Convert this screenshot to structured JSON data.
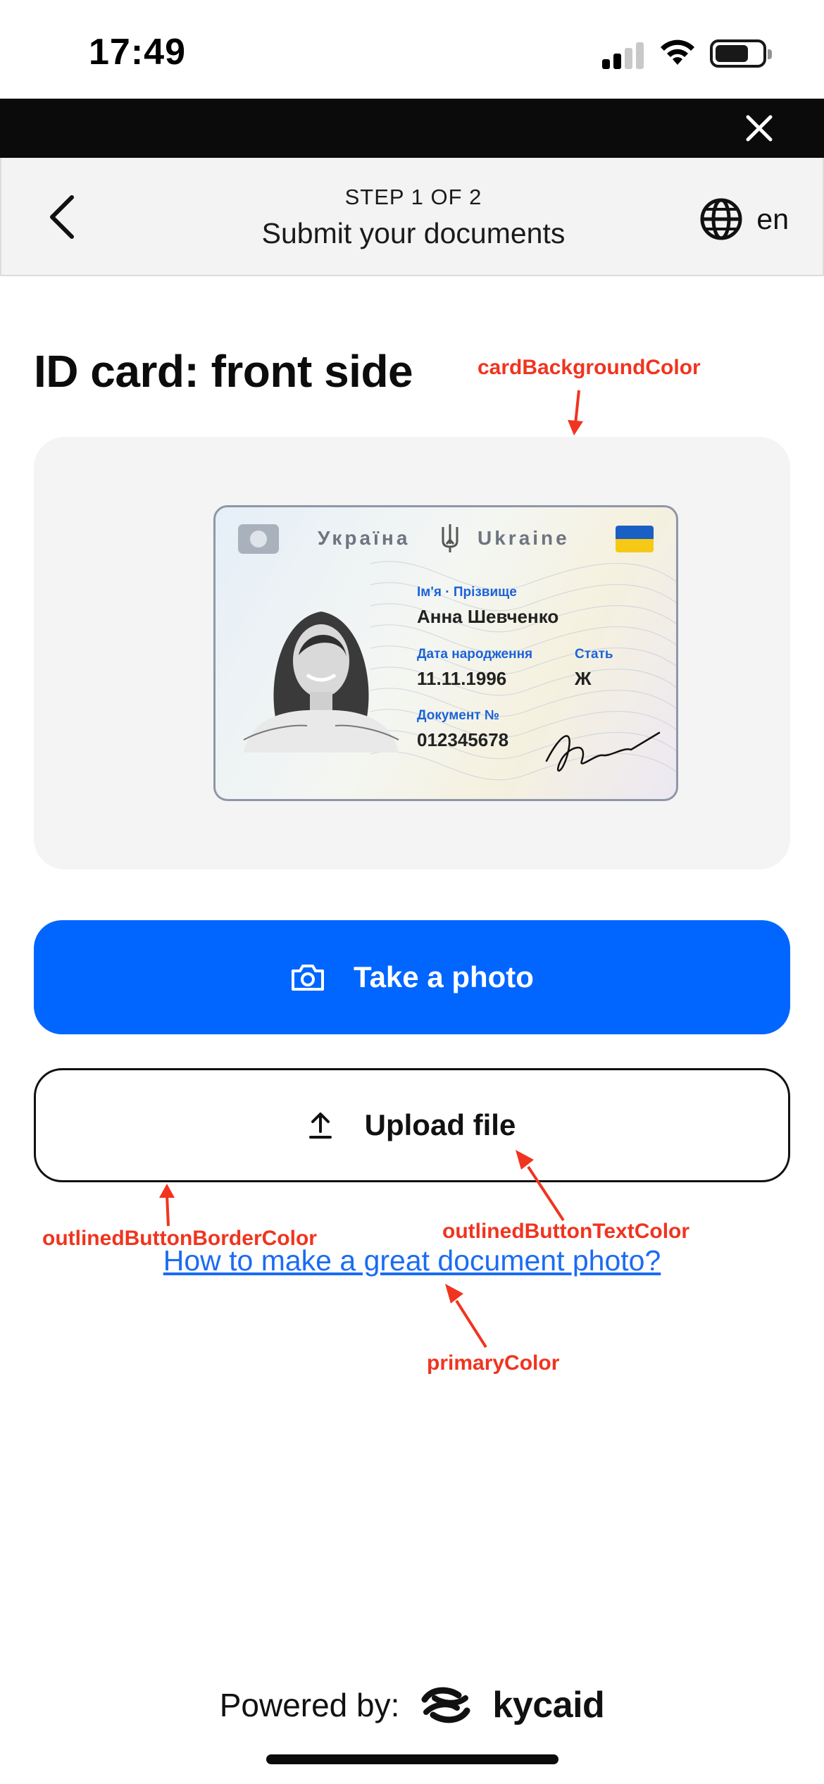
{
  "status_bar": {
    "time": "17:49",
    "icons": [
      "signal-icon",
      "wifi-icon",
      "battery-icon"
    ]
  },
  "top_strip": {
    "close_icon": "close-icon"
  },
  "header": {
    "back_icon": "chevron-left-icon",
    "step": "STEP 1 OF 2",
    "title": "Submit your documents",
    "language_icon": "globe-icon",
    "language": "en"
  },
  "page": {
    "title": "ID card: front side"
  },
  "id_card": {
    "country_native": "Україна",
    "country_en": "Ukraine",
    "name_label": "Ім'я · Прізвище",
    "name_value": "Анна Шевченко",
    "dob_label": "Дата народження",
    "dob_value": "11.11.1996",
    "sex_label": "Стать",
    "sex_value": "Ж",
    "doc_label": "Документ №",
    "doc_value": "012345678"
  },
  "buttons": {
    "take_photo": "Take a photo",
    "take_photo_icon": "camera-icon",
    "upload_file": "Upload file",
    "upload_icon": "upload-icon"
  },
  "help_link": "How to make a great document photo?",
  "annotations": {
    "card_bg": "cardBackgroundColor",
    "outlined_border": "outlinedButtonBorderColor",
    "outlined_text": "outlinedButtonTextColor",
    "primary": "primaryColor"
  },
  "footer": {
    "powered_by": "Powered by:",
    "brand": "kycaid",
    "brand_icon": "kycaid-logo-icon"
  },
  "colors": {
    "primary": "#0066ff",
    "card_background": "#f4f4f4",
    "outlined_border": "#111111",
    "outlined_text": "#111111",
    "link": "#1b6cf2",
    "annotation": "#f0341f",
    "header_background": "#f3f3f3"
  }
}
